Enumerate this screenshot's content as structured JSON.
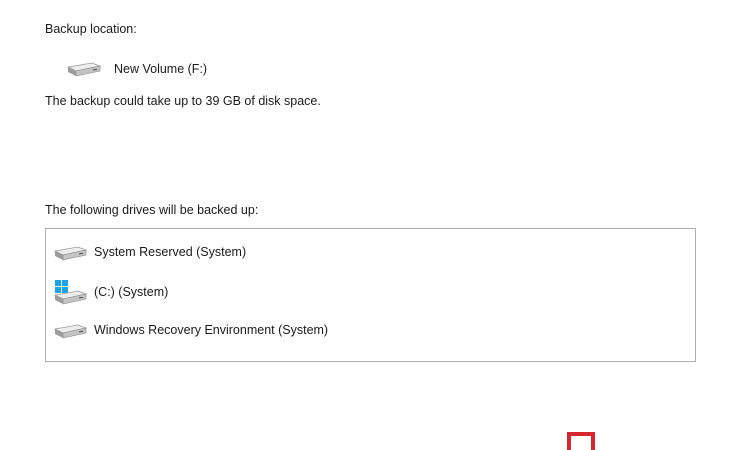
{
  "backup_location": {
    "label": "Backup location:",
    "drive_name": "New Volume (F:)",
    "drive_icon": "hard-drive-icon"
  },
  "space_notice": "The backup could take up to 39 GB of disk space.",
  "drives_section": {
    "label": "The following drives will be backed up:",
    "items": [
      {
        "label": "System Reserved (System)",
        "icon": "hard-drive-icon"
      },
      {
        "label": "(C:) (System)",
        "icon": "windows-drive-icon"
      },
      {
        "label": "Windows Recovery Environment (System)",
        "icon": "hard-drive-icon"
      }
    ]
  },
  "colors": {
    "accent_windows": "#1aa3e8",
    "marker_red": "#d8262e",
    "list_border": "#adadad"
  }
}
